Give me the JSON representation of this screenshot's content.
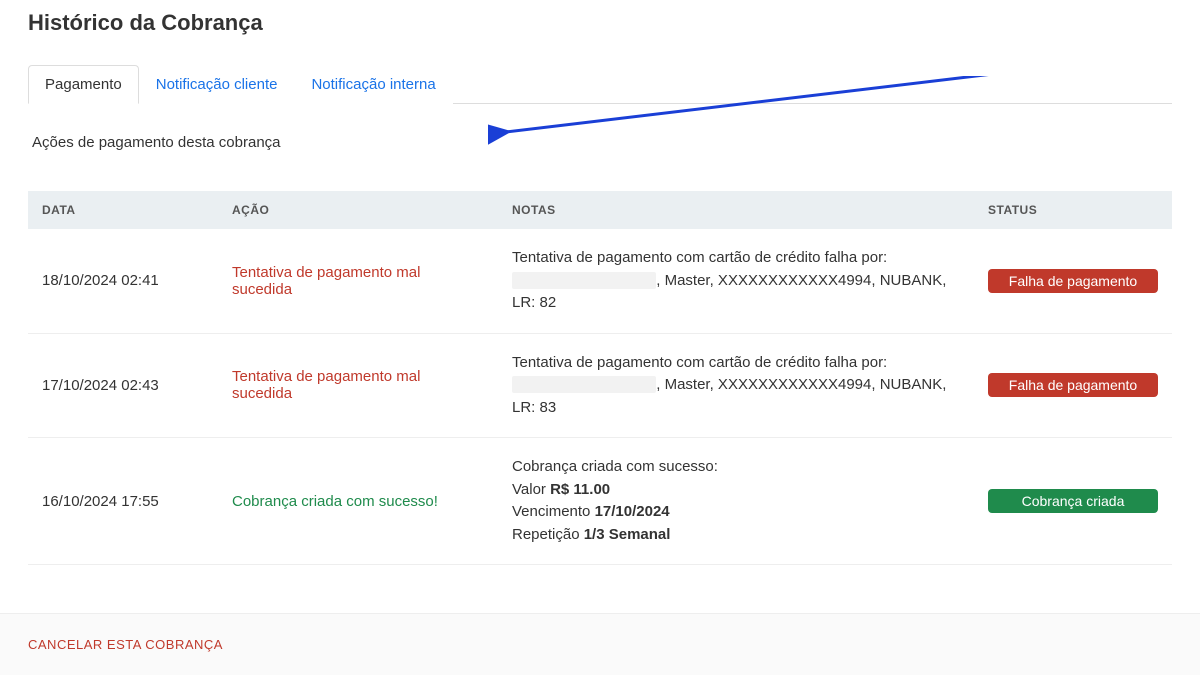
{
  "header": {
    "title": "Histórico da Cobrança"
  },
  "tabs": {
    "items": [
      {
        "label": "Pagamento"
      },
      {
        "label": "Notificação cliente"
      },
      {
        "label": "Notificação interna"
      }
    ]
  },
  "section": {
    "description": "Ações de pagamento desta cobrança"
  },
  "table": {
    "headers": {
      "date": "DATA",
      "action": "AÇÃO",
      "notes": "NOTAS",
      "status": "STATUS"
    },
    "rows": [
      {
        "date": "18/10/2024 02:41",
        "action": "Tentativa de pagamento mal sucedida",
        "action_style": "failed",
        "notes_prefix": "Tentativa de pagamento com cartão de crédito falha por: ",
        "notes_suffix": ", Master, XXXXXXXXXXXX4994, NUBANK, LR: 82",
        "status_label": "Falha de pagamento",
        "status_style": "red"
      },
      {
        "date": "17/10/2024 02:43",
        "action": "Tentativa de pagamento mal sucedida",
        "action_style": "failed",
        "notes_prefix": "Tentativa de pagamento com cartão de crédito falha por: ",
        "notes_suffix": ", Master, XXXXXXXXXXXX4994, NUBANK, LR: 83",
        "status_label": "Falha de pagamento",
        "status_style": "red"
      },
      {
        "date": "16/10/2024 17:55",
        "action": "Cobrança criada com sucesso!",
        "action_style": "success",
        "notes_multiline": {
          "l1": "Cobrança criada com sucesso:",
          "l2a": "Valor ",
          "l2b": "R$ 11.00",
          "l3a": "Vencimento ",
          "l3b": "17/10/2024",
          "l4a": "Repetição ",
          "l4b": "1/3 Semanal"
        },
        "status_label": "Cobrança criada",
        "status_style": "green"
      }
    ]
  },
  "footer": {
    "cancel_label": "CANCELAR ESTA COBRANÇA"
  }
}
